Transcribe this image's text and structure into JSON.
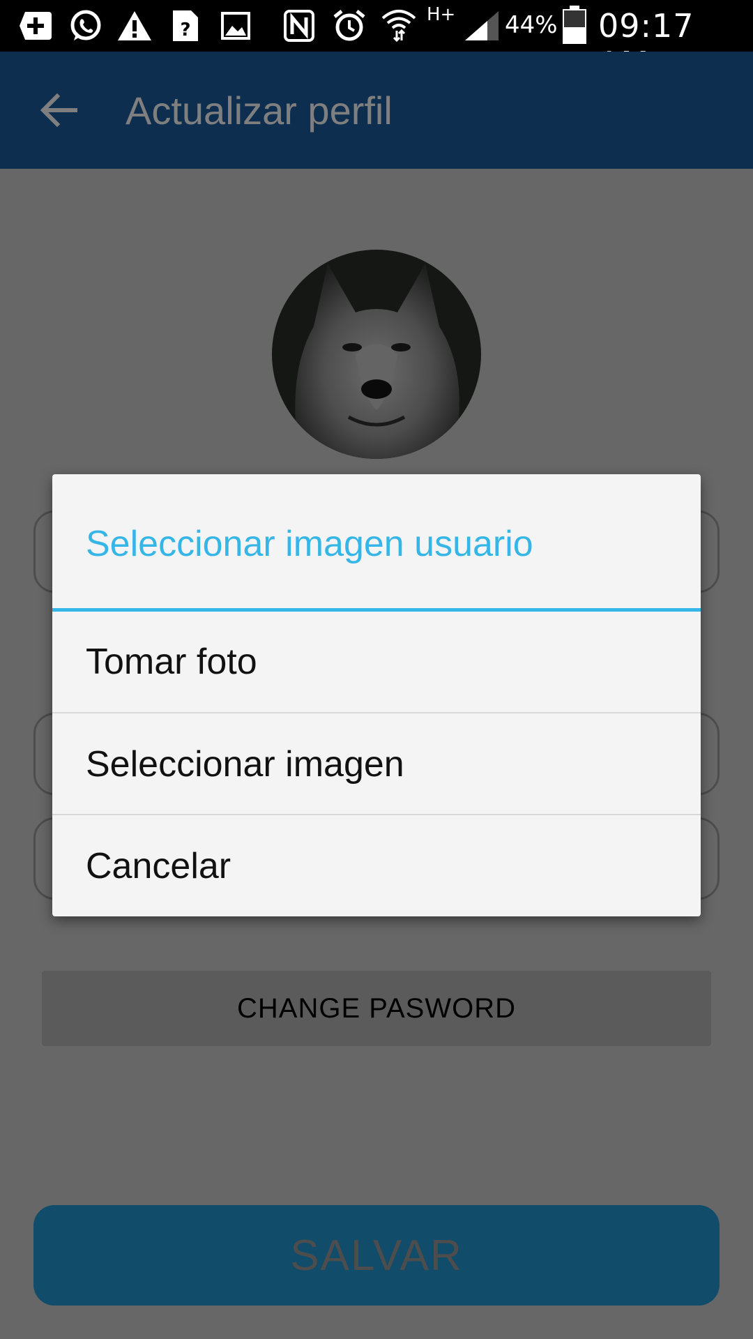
{
  "status_bar": {
    "battery_percent": "44%",
    "network": "H+",
    "time": "09:17 AM"
  },
  "appbar": {
    "title": "Actualizar perfil"
  },
  "form": {
    "change_password_label": "CHANGE PASWORD",
    "save_label": "SALVAR"
  },
  "dialog": {
    "title": "Seleccionar imagen usuario",
    "items": [
      {
        "label": "Tomar foto"
      },
      {
        "label": "Seleccionar imagen"
      },
      {
        "label": "Cancelar"
      }
    ]
  },
  "colors": {
    "appbar": "#1a5c9d",
    "accent": "#35b6e6",
    "save_button": "#2299d6"
  }
}
